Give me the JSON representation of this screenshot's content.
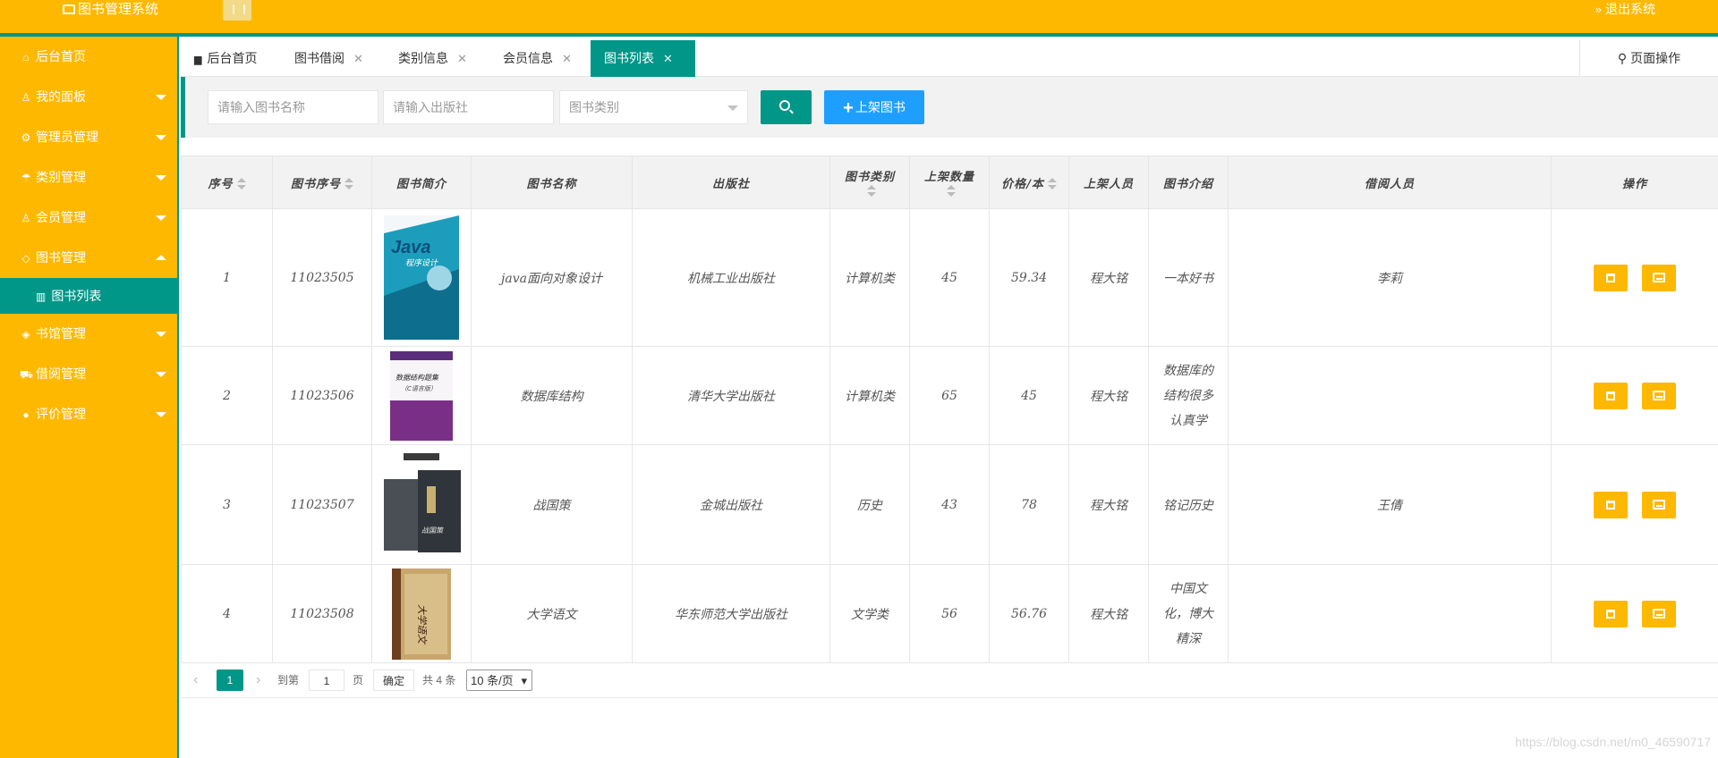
{
  "header": {
    "brand": "图书管理系统",
    "logout": "退出系统"
  },
  "sidebar": {
    "items": [
      {
        "label": "后台首页",
        "icon": "home-icon"
      },
      {
        "label": "我的面板",
        "icon": "user-icon"
      },
      {
        "label": "管理员管理",
        "icon": "gear-icon"
      },
      {
        "label": "类别管理",
        "icon": "umbrella-icon"
      },
      {
        "label": "会员管理",
        "icon": "users-icon"
      },
      {
        "label": "图书管理",
        "icon": "tag-icon"
      },
      {
        "label": "书馆管理",
        "icon": "layers-icon"
      },
      {
        "label": "借阅管理",
        "icon": "cart-icon"
      },
      {
        "label": "评价管理",
        "icon": "chat-icon"
      }
    ],
    "active_sub": "图书列表"
  },
  "tabs": {
    "items": [
      {
        "label": "后台首页"
      },
      {
        "label": "图书借阅"
      },
      {
        "label": "类别信息"
      },
      {
        "label": "会员信息"
      },
      {
        "label": "图书列表"
      }
    ],
    "page_ops": "页面操作"
  },
  "search": {
    "name_placeholder": "请输入图书名称",
    "publisher_placeholder": "请输入出版社",
    "category_placeholder": "图书类别",
    "add_label": "上架图书"
  },
  "table": {
    "headers": [
      "序号",
      "图书序号",
      "图书简介",
      "图书名称",
      "出版社",
      "图书类别",
      "上架数量",
      "价格/本",
      "上架人员",
      "图书介绍",
      "借阅人员",
      "操作"
    ],
    "rows": [
      {
        "no": "1",
        "book_no": "11023505",
        "name": "java面向对象设计",
        "publisher": "机械工业出版社",
        "category": "计算机类",
        "qty": "45",
        "price": "59.34",
        "staff": "程大铭",
        "intro": "一本好书",
        "borrower": "李莉"
      },
      {
        "no": "2",
        "book_no": "11023506",
        "name": "数据库结构",
        "publisher": "清华大学出版社",
        "category": "计算机类",
        "qty": "65",
        "price": "45",
        "staff": "程大铭",
        "intro": "数据库的结构很多认真学",
        "borrower": ""
      },
      {
        "no": "3",
        "book_no": "11023507",
        "name": "战国策",
        "publisher": "金城出版社",
        "category": "历史",
        "qty": "43",
        "price": "78",
        "staff": "程大铭",
        "intro": "铭记历史",
        "borrower": "王倩"
      },
      {
        "no": "4",
        "book_no": "11023508",
        "name": "大学语文",
        "publisher": "华东师范大学出版社",
        "category": "文学类",
        "qty": "56",
        "price": "56.76",
        "staff": "程大铭",
        "intro": "中国文化，博大精深",
        "borrower": ""
      }
    ],
    "covers": [
      {
        "title": "Java",
        "subtitle": "程序设计"
      },
      {
        "title": "数据结构题集",
        "subtitle": "（C语言版）"
      },
      {
        "title": "战国策",
        "subtitle": ""
      },
      {
        "title": "大学语文",
        "subtitle": ""
      }
    ]
  },
  "pager": {
    "current": "1",
    "goto_label": "到第",
    "page_value": "1",
    "page_unit": "页",
    "confirm": "确定",
    "total": "共 4 条",
    "page_size": "10 条/页"
  },
  "watermark": "https://blog.csdn.net/m0_46590717",
  "colors": {
    "accent": "#FFB800",
    "primary": "#009688",
    "blue": "#1E9FFF"
  }
}
